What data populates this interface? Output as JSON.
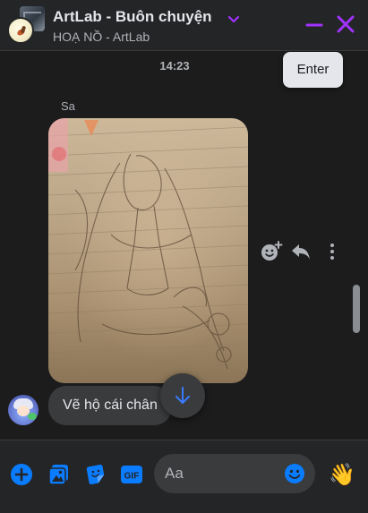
{
  "header": {
    "title": "ArtLab - Buôn chuyện",
    "subtitle": "HOẠ NỒ - ArtLab"
  },
  "conversation": {
    "timestamp": "14:23",
    "tooltip": "Enter",
    "sender_name": "Sa",
    "text_message": "Vẽ hộ cái chân"
  },
  "composer": {
    "placeholder": "Aa",
    "wave_emoji": "👋"
  },
  "colors": {
    "accent_purple": "#a033ff",
    "messenger_blue": "#0a7cff",
    "background": "#1c1c1d",
    "panel": "#242526",
    "bubble": "#3a3b3c"
  },
  "icons": {
    "header": [
      "chevron-down-icon",
      "minimize-icon",
      "close-icon"
    ],
    "message_actions": [
      "react-icon",
      "reply-icon",
      "more-options-icon"
    ],
    "composer": [
      "plus-icon",
      "photo-icon",
      "sticker-icon",
      "gif-icon",
      "emoji-icon",
      "wave-emoji"
    ]
  }
}
